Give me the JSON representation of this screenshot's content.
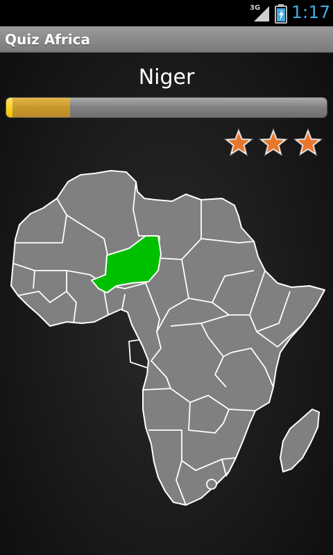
{
  "status_bar": {
    "network": "3G",
    "time": "1:17",
    "icons": [
      "signal-icon",
      "battery-charging-icon"
    ]
  },
  "app": {
    "title": "Quiz Africa"
  },
  "quiz": {
    "country": "Niger",
    "progress": 0.2,
    "stars": 3
  },
  "colors": {
    "highlight": "#00c000",
    "land": "#808080",
    "border": "#ffffff",
    "star": "#e8772e",
    "accent": "#45a9e0"
  },
  "map": {
    "region": "Africa",
    "highlighted_country": "Niger"
  }
}
